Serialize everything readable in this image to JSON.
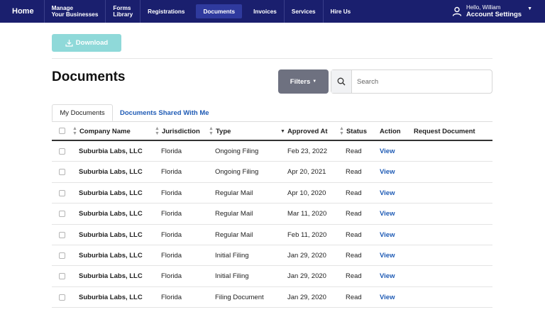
{
  "nav": {
    "home": "Home",
    "items": [
      {
        "line1": "Manage",
        "line2": "Your Businesses"
      },
      {
        "line1": "Forms",
        "line2": "Library"
      },
      {
        "label": "Registrations"
      },
      {
        "label": "Documents"
      },
      {
        "label": "Invoices"
      },
      {
        "label": "Services"
      },
      {
        "label": "Hire Us"
      }
    ],
    "active": "Documents",
    "account": {
      "greeting": "Hello, William",
      "settings": "Account Settings"
    }
  },
  "download_label": "Download",
  "page_title": "Documents",
  "filters_label": "Filters",
  "search": {
    "placeholder": "Search",
    "value": ""
  },
  "tabs": [
    {
      "label": "My Documents",
      "active": true
    },
    {
      "label": "Documents Shared With Me",
      "active": false
    }
  ],
  "table": {
    "headers": {
      "company": "Company Name",
      "jurisdiction": "Jurisdiction",
      "type": "Type",
      "approved": "Approved At",
      "status": "Status",
      "action": "Action",
      "request": "Request Document"
    },
    "sorted_by": "Approved At",
    "rows": [
      {
        "company": "Suburbia Labs, LLC",
        "jurisdiction": "Florida",
        "type": "Ongoing Filing",
        "approved": "Feb 23, 2022",
        "status": "Read",
        "action": "View"
      },
      {
        "company": "Suburbia Labs, LLC",
        "jurisdiction": "Florida",
        "type": "Ongoing Filing",
        "approved": "Apr 20, 2021",
        "status": "Read",
        "action": "View"
      },
      {
        "company": "Suburbia Labs, LLC",
        "jurisdiction": "Florida",
        "type": "Regular Mail",
        "approved": "Apr 10, 2020",
        "status": "Read",
        "action": "View"
      },
      {
        "company": "Suburbia Labs, LLC",
        "jurisdiction": "Florida",
        "type": "Regular Mail",
        "approved": "Mar 11, 2020",
        "status": "Read",
        "action": "View"
      },
      {
        "company": "Suburbia Labs, LLC",
        "jurisdiction": "Florida",
        "type": "Regular Mail",
        "approved": "Feb 11, 2020",
        "status": "Read",
        "action": "View"
      },
      {
        "company": "Suburbia Labs, LLC",
        "jurisdiction": "Florida",
        "type": "Initial Filing",
        "approved": "Jan 29, 2020",
        "status": "Read",
        "action": "View"
      },
      {
        "company": "Suburbia Labs, LLC",
        "jurisdiction": "Florida",
        "type": "Initial Filing",
        "approved": "Jan 29, 2020",
        "status": "Read",
        "action": "View"
      },
      {
        "company": "Suburbia Labs, LLC",
        "jurisdiction": "Florida",
        "type": "Filing Document",
        "approved": "Jan 29, 2020",
        "status": "Read",
        "action": "View"
      }
    ]
  },
  "colors": {
    "nav_bg": "#1a1f6e",
    "nav_active": "#2f3a9e",
    "download_bg": "#8fd9d9",
    "filters_bg": "#6e7180",
    "link": "#1f5bb5"
  }
}
